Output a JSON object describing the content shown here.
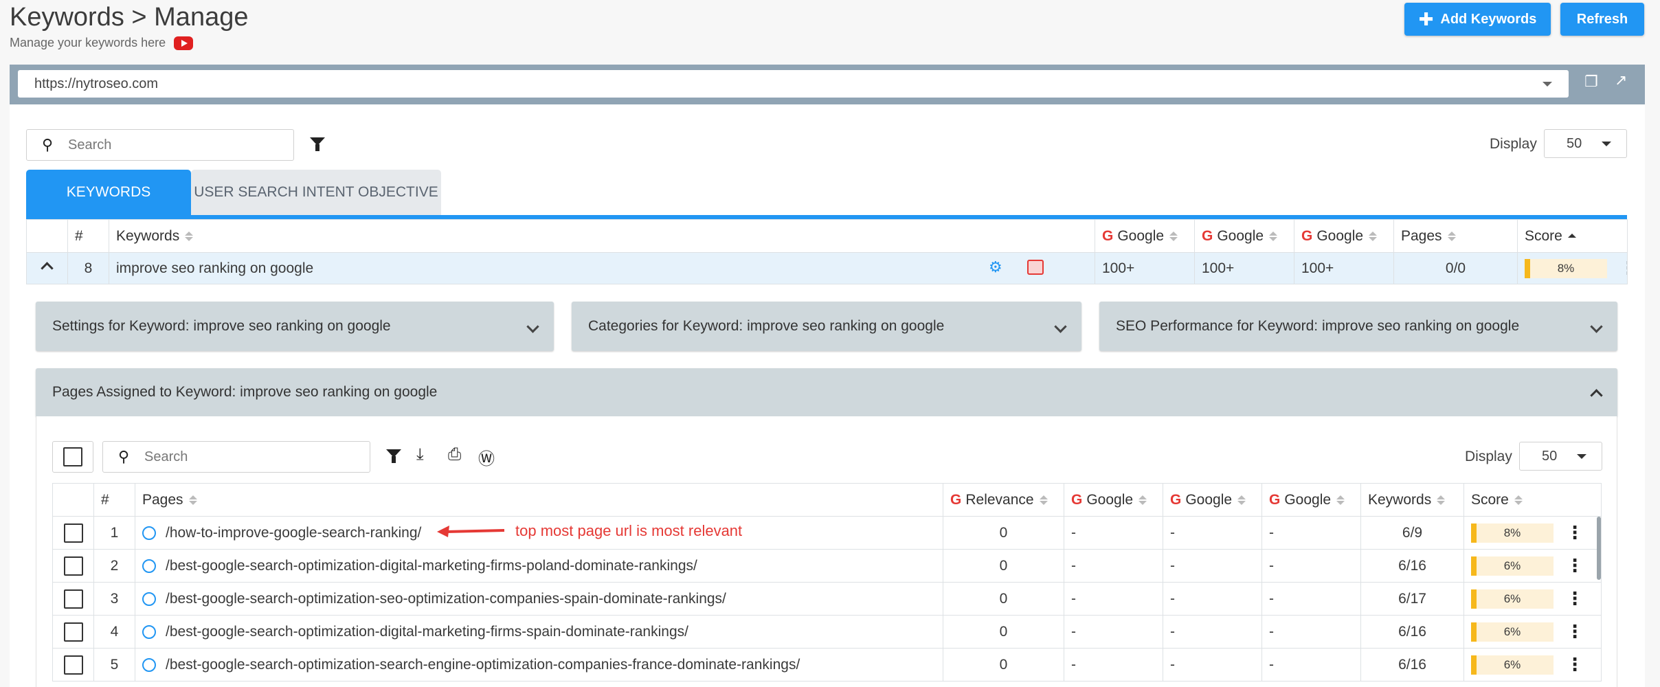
{
  "header": {
    "title": "Keywords > Manage",
    "subtitle": "Manage your keywords here",
    "add_keywords": "Add Keywords",
    "refresh": "Refresh"
  },
  "url_bar": {
    "value": "https://nytroseo.com"
  },
  "toolbar": {
    "search_placeholder": "Search",
    "display_label": "Display",
    "display_value": "50"
  },
  "tabs": [
    {
      "label": "KEYWORDS",
      "active": true
    },
    {
      "label": "USER SEARCH INTENT OBJECTIVE",
      "active": false
    }
  ],
  "keywords_table": {
    "headers": [
      "#",
      "Keywords",
      "Google",
      "Google",
      "Google",
      "Pages",
      "Score"
    ],
    "row": {
      "num": "8",
      "keyword": "improve seo ranking on google",
      "g1": "100+",
      "g2": "100+",
      "g3": "100+",
      "pages": "0/0",
      "score": "8%"
    }
  },
  "accordions": {
    "settings": "Settings for Keyword: improve seo ranking on google",
    "categories": "Categories for Keyword: improve seo ranking on google",
    "seo_performance": "SEO Performance for Keyword: improve seo ranking on google",
    "pages_assigned": "Pages Assigned to Keyword: improve seo ranking on google"
  },
  "pages_toolbar": {
    "search_placeholder": "Search",
    "display_label": "Display",
    "display_value": "50"
  },
  "pages_table": {
    "headers": [
      "#",
      "Pages",
      "Relevance",
      "Google",
      "Google",
      "Google",
      "Keywords",
      "Score"
    ],
    "rows": [
      {
        "num": "1",
        "page": "/how-to-improve-google-search-ranking/",
        "relevance": "0",
        "g1": "-",
        "g2": "-",
        "g3": "-",
        "keywords": "6/9",
        "score": "8%"
      },
      {
        "num": "2",
        "page": "/best-google-search-optimization-digital-marketing-firms-poland-dominate-rankings/",
        "relevance": "0",
        "g1": "-",
        "g2": "-",
        "g3": "-",
        "keywords": "6/16",
        "score": "6%"
      },
      {
        "num": "3",
        "page": "/best-google-search-optimization-seo-optimization-companies-spain-dominate-rankings/",
        "relevance": "0",
        "g1": "-",
        "g2": "-",
        "g3": "-",
        "keywords": "6/17",
        "score": "6%"
      },
      {
        "num": "4",
        "page": "/best-google-search-optimization-digital-marketing-firms-spain-dominate-rankings/",
        "relevance": "0",
        "g1": "-",
        "g2": "-",
        "g3": "-",
        "keywords": "6/16",
        "score": "6%"
      },
      {
        "num": "5",
        "page": "/best-google-search-optimization-search-engine-optimization-companies-france-dominate-rankings/",
        "relevance": "0",
        "g1": "-",
        "g2": "-",
        "g3": "-",
        "keywords": "6/16",
        "score": "6%"
      }
    ]
  },
  "annotation": {
    "text": "top most page url is most relevant"
  },
  "colors": {
    "primary": "#2196f3",
    "accent_red": "#e53935",
    "score_fill": "#f6b81c"
  }
}
